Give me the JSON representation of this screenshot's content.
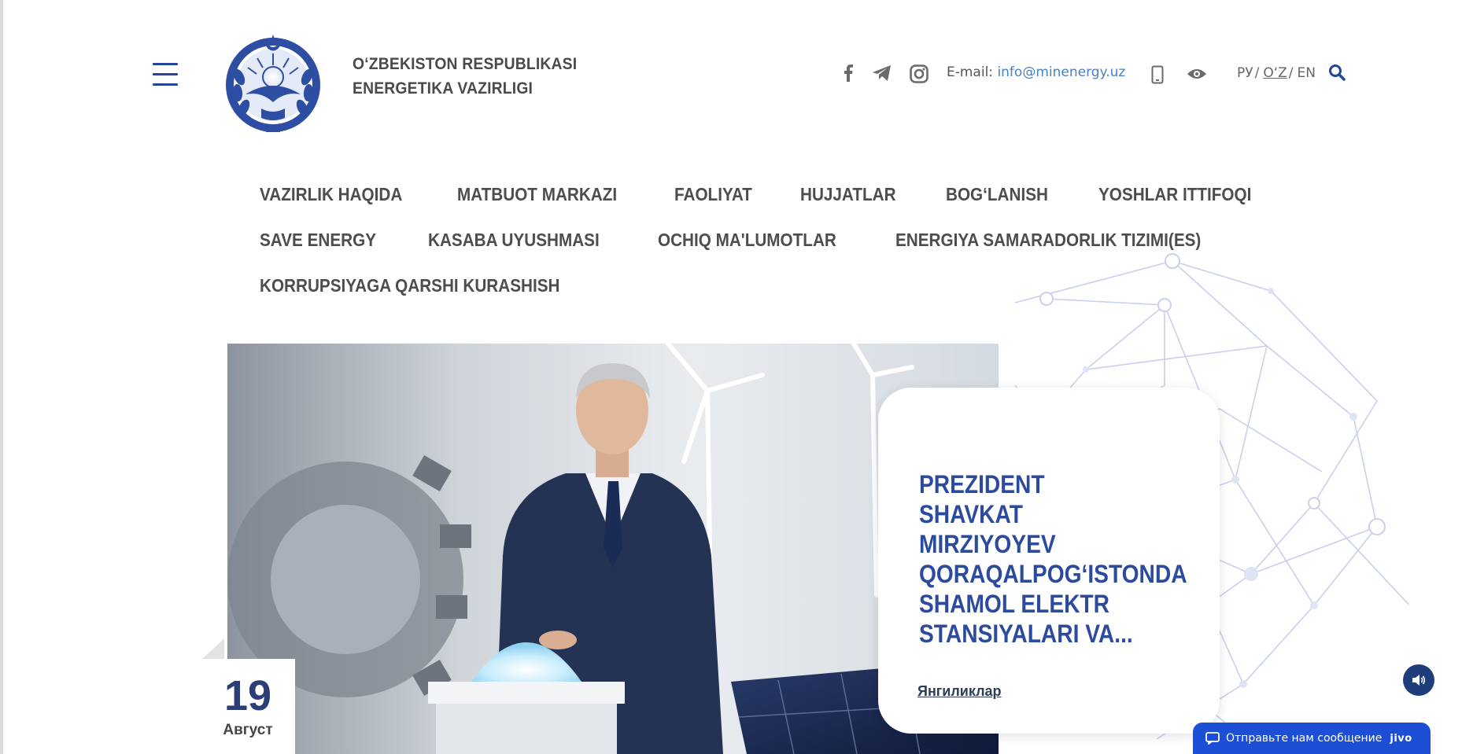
{
  "header": {
    "org_line1": "O‘ZBEKISTON RESPUBLIKASI",
    "org_line2": "ENERGETIKA VAZIRLIGI",
    "email_label": "E-mail:",
    "email": "info@minenergy.uz",
    "languages": [
      {
        "label": "РУ",
        "active": false
      },
      {
        "label": "O‘Z",
        "active": true
      },
      {
        "label": "EN",
        "active": false
      }
    ],
    "lang_separator": "/",
    "icons": {
      "menu": "hamburger-menu-icon",
      "facebook": "facebook-icon",
      "telegram": "telegram-icon",
      "instagram": "instagram-icon",
      "mobile": "mobile-version-icon",
      "visually_impaired": "eye-icon",
      "search": "search-icon"
    }
  },
  "menu": {
    "row1": [
      "VAZIRLIK HAQIDA",
      "MATBUOT MARKAZI",
      "FAOLIYAT",
      "HUJJATLAR",
      "BOG‘LANISH",
      "YOSHLAR ITTIFOQI"
    ],
    "row2": [
      "SAVE ENERGY",
      "KASABA UYUSHMASI",
      "OCHIQ MA'LUMOTLAR",
      "ENERGIYA SAMARADORLIK TIZIMI(ES)"
    ],
    "row3": [
      "KORRUPSIYAGA QARSHI KURASHISH"
    ]
  },
  "hero": {
    "title": "PREZIDENT SHAVKAT MIRZIYOYEV QORAQALPOG‘ISTONDA SHAMOL ELEKTR STANSIYALARI VA...",
    "category": "Янгиликлар",
    "date_day": "19",
    "date_month": "Август"
  },
  "chat": {
    "label": "Отправьте нам сообщение",
    "brand": "jivo"
  },
  "colors": {
    "brand_blue": "#23469a",
    "title_blue": "#2c4b9e",
    "link_blue": "#4a7fc1",
    "chat_blue": "#1c4fd6"
  }
}
